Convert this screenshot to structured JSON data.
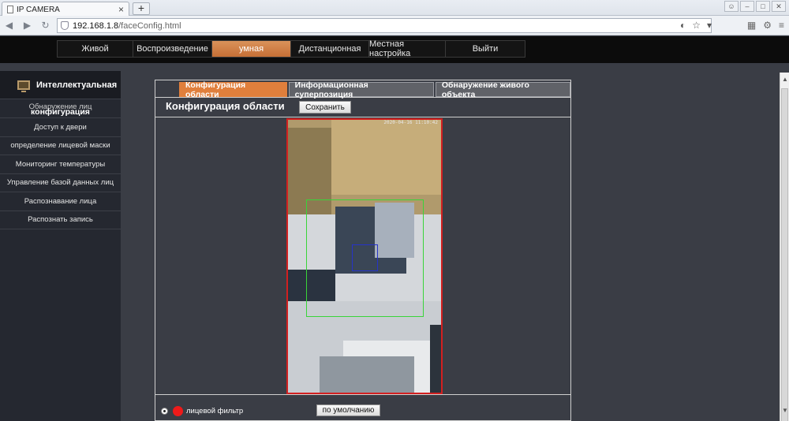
{
  "browser": {
    "tab_title": "IP CAMERA",
    "tab_close": "×",
    "new_tab": "+",
    "url_host": "192.168.1.8",
    "url_path": "/faceConfig.html"
  },
  "appnav": {
    "items": [
      {
        "label": "Живой"
      },
      {
        "label": "Воспроизведение"
      },
      {
        "label": "умная"
      },
      {
        "label": "Дистанционная"
      },
      {
        "label": "Местная настройка"
      },
      {
        "label": "Выйти"
      }
    ],
    "active_index": 2
  },
  "sidebar": {
    "header": "Интеллектуальная",
    "first_item": {
      "label": "Обнаружение лиц",
      "overlay": "конфигурация"
    },
    "items": [
      {
        "label": "Доступ к двери"
      },
      {
        "label": "определение лицевой маски"
      },
      {
        "label": "Мониторинг температуры"
      },
      {
        "label": "Управление базой данных лиц"
      },
      {
        "label": "Распознавание лица"
      },
      {
        "label": "Распознать запись"
      }
    ]
  },
  "panel": {
    "tabs": [
      {
        "label": "Конфигурация области"
      },
      {
        "label": "Информационная суперпозиция"
      },
      {
        "label": "Обнаружение живого объекта"
      }
    ],
    "active_tab": 0,
    "title": "Конфигурация области",
    "save_label": "Сохранить",
    "osd_text": "2020-04-16 11:10:42",
    "face_filter_label": "лицевой фильтр",
    "default_label": "по умолчанию"
  },
  "colors": {
    "accent": "#e07f3c",
    "zone": "#39d439",
    "face_box": "#2634c8",
    "frame": "#d22020",
    "filter_dot": "#ee1a1a"
  }
}
